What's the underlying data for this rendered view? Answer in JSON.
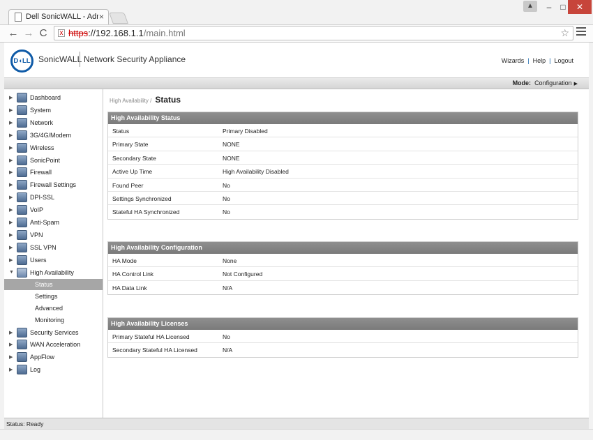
{
  "browser": {
    "tab_title": "Dell SonicWALL - Administration",
    "tab_close": "×",
    "url_scheme": "https",
    "url_host": "://192.168.1.1",
    "url_path": "/main.html",
    "bookmark_glyph": "☆",
    "back_glyph": "←",
    "forward_glyph": "→",
    "reload_glyph": "C",
    "user_glyph": "▲",
    "minimize_glyph": "–",
    "maximize_glyph": "□",
    "close_glyph": "✕"
  },
  "header": {
    "logo_text": "D◖LL",
    "brand": "SonicWALL",
    "product": "Network Security Appliance",
    "links": [
      "Wizards",
      "Help",
      "Logout"
    ],
    "link_separator": "|"
  },
  "modebar": {
    "label": "Mode:",
    "value": "Configuration",
    "arrow": "▶"
  },
  "sidebar": {
    "items": [
      {
        "label": "Dashboard",
        "icon": "dashboard-icon"
      },
      {
        "label": "System",
        "icon": "system-icon"
      },
      {
        "label": "Network",
        "icon": "network-icon"
      },
      {
        "label": "3G/4G/Modem",
        "icon": "modem-icon"
      },
      {
        "label": "Wireless",
        "icon": "wireless-icon"
      },
      {
        "label": "SonicPoint",
        "icon": "sonicpoint-icon"
      },
      {
        "label": "Firewall",
        "icon": "firewall-icon"
      },
      {
        "label": "Firewall Settings",
        "icon": "firewall-settings-icon"
      },
      {
        "label": "DPI-SSL",
        "icon": "dpi-ssl-icon"
      },
      {
        "label": "VoIP",
        "icon": "voip-icon"
      },
      {
        "label": "Anti-Spam",
        "icon": "anti-spam-icon"
      },
      {
        "label": "VPN",
        "icon": "vpn-icon"
      },
      {
        "label": "SSL VPN",
        "icon": "ssl-vpn-icon"
      },
      {
        "label": "Users",
        "icon": "users-icon"
      },
      {
        "label": "High Availability",
        "icon": "high-availability-icon"
      }
    ],
    "sub_items": [
      "Status",
      "Settings",
      "Advanced",
      "Monitoring"
    ],
    "items_after": [
      {
        "label": "Security Services",
        "icon": "security-services-icon"
      },
      {
        "label": "WAN Acceleration",
        "icon": "wan-acceleration-icon"
      },
      {
        "label": "AppFlow",
        "icon": "appflow-icon"
      },
      {
        "label": "Log",
        "icon": "log-icon"
      }
    ],
    "collapsed_arrow": "▶",
    "expanded_arrow": "▼",
    "active_sub_item": "Status"
  },
  "content": {
    "breadcrumb_parent": "High Availability /",
    "breadcrumb_current": "Status",
    "sections": [
      {
        "title": "High Availability Status",
        "rows": [
          {
            "label": "Status",
            "value": "Primary Disabled"
          },
          {
            "label": "Primary State",
            "value": "NONE"
          },
          {
            "label": "Secondary State",
            "value": "NONE"
          },
          {
            "label": "Active Up Time",
            "value": "High Availability Disabled"
          },
          {
            "label": "Found Peer",
            "value": "No"
          },
          {
            "label": "Settings Synchronized",
            "value": "No"
          },
          {
            "label": "Stateful HA Synchronized",
            "value": "No"
          }
        ]
      },
      {
        "title": "High Availability Configuration",
        "rows": [
          {
            "label": "HA Mode",
            "value": "None"
          },
          {
            "label": "HA Control Link",
            "value": "Not Configured"
          },
          {
            "label": "HA Data Link",
            "value": "N/A"
          }
        ]
      },
      {
        "title": "High Availability Licenses",
        "rows": [
          {
            "label": "Primary Stateful HA Licensed",
            "value": "No"
          },
          {
            "label": "Secondary Stateful HA Licensed",
            "value": "N/A"
          }
        ]
      }
    ]
  },
  "statusbar": {
    "text": "Status: Ready"
  }
}
